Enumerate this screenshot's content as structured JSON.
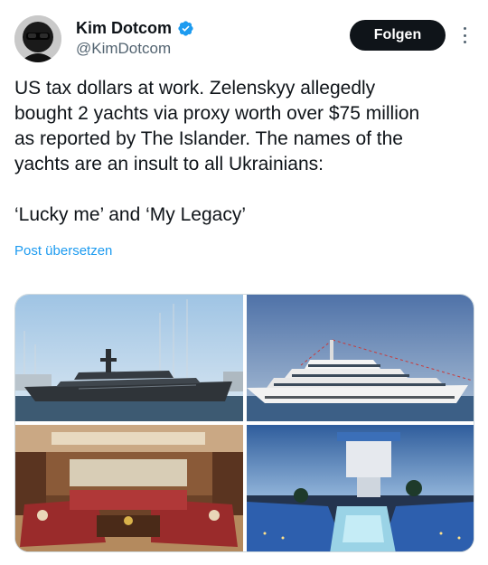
{
  "author": {
    "display_name": "Kim Dotcom",
    "handle": "@KimDotcom",
    "verified": true,
    "avatar_icon": "profile-avatar"
  },
  "actions": {
    "follow_label": "Folgen",
    "more_icon": "more-vertical-icon"
  },
  "tweet": {
    "line1": "US tax dollars at work. Zelenskyy allegedly",
    "line2": "bought 2 yachts via proxy worth over $75 million",
    "line3": "as reported by The Islander. The names of the",
    "line4": "yachts are an insult to all Ukrainians:",
    "line5": "‘Lucky me’ and ‘My Legacy’"
  },
  "translate_label": "Post übersetzen",
  "colors": {
    "accent": "#1d9bf0",
    "text": "#0f1419",
    "secondary": "#536471",
    "follow_bg": "#0f1419"
  },
  "media": [
    {
      "icon": "dark-yacht-in-marina-photo"
    },
    {
      "icon": "white-yacht-at-sea-photo"
    },
    {
      "icon": "yacht-salon-interior-photo"
    },
    {
      "icon": "yacht-pool-deck-photo"
    }
  ]
}
